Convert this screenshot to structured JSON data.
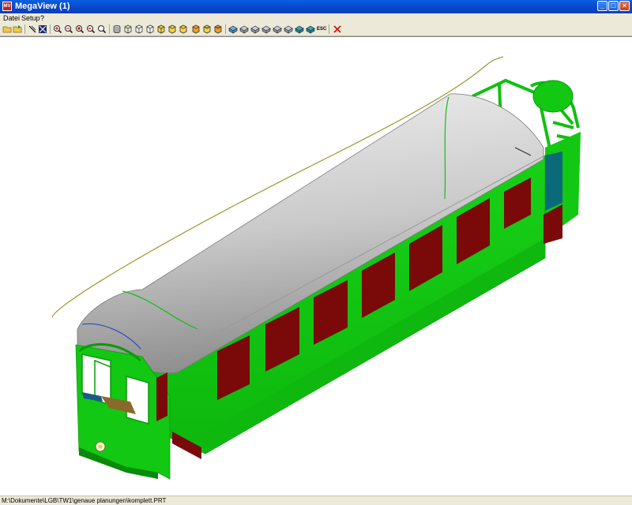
{
  "window": {
    "title": "MegaView (1)",
    "app_icon_text": "MV"
  },
  "menu": {
    "items": [
      "Datei",
      "Setup",
      "?"
    ]
  },
  "toolbar": {
    "buttons": [
      "open-file-icon",
      "save-file-icon",
      "select-line-icon",
      "select-cross-icon",
      "zoom-in-icon",
      "zoom-out-icon",
      "zoom-window-icon",
      "zoom-previous-icon",
      "zoom-fit-icon",
      "shade-solid-icon",
      "shade-wire-icon",
      "shade-hidden-icon",
      "shade-flat-icon",
      "shade-gouraud-icon",
      "view-cube-1-icon",
      "view-cube-2-icon",
      "view-cube-3-icon",
      "view-front-icon",
      "view-back-icon",
      "view-left-icon",
      "view-right-icon",
      "view-top-icon",
      "view-bottom-icon",
      "view-iso-icon",
      "escape-icon",
      "exit-icon"
    ],
    "escape_label": "ESC"
  },
  "status": {
    "path": "M:\\Dokumente\\LGB\\TW1\\genaue planungen\\komplett.PRT"
  },
  "colors": {
    "title_bar": "#0a5fe0",
    "body_green": "#12c812",
    "window_red": "#7a0a0a",
    "roof_grey": "#c8c8c8",
    "canvas": "#ffffff"
  }
}
